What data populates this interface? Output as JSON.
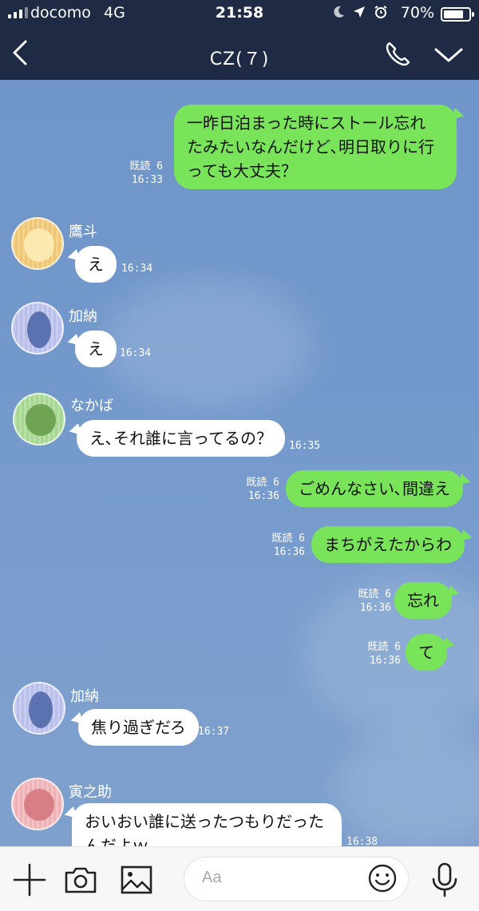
{
  "status_bar": {
    "carrier": "docomo",
    "network": "4G",
    "time": "21:58",
    "battery_percent": "70%",
    "battery_level": 0.7,
    "icons": [
      "moon-icon",
      "location-icon",
      "alarm-icon"
    ]
  },
  "header": {
    "title": "CZ(７)",
    "icons": [
      "back-icon",
      "phone-icon",
      "chevron-down-icon"
    ]
  },
  "messages": [
    {
      "direction": "out",
      "text": "一昨日泊まった時にストール忘れ\nたみたいなんだけど､明日取りに行\nっても大丈夫？",
      "read": "既読 6",
      "time": "16:33"
    },
    {
      "direction": "in",
      "sender": "鷹斗",
      "text": "え",
      "time": "16:34"
    },
    {
      "direction": "in",
      "sender": "加納",
      "text": "え",
      "time": "16:34"
    },
    {
      "direction": "in",
      "sender": "なかば",
      "text": "え､それ誰に言ってるの？",
      "time": "16:35"
    },
    {
      "direction": "out",
      "text": "ごめんなさい､間違え",
      "read": "既読 6",
      "time": "16:36"
    },
    {
      "direction": "out",
      "text": "まちがえたからわ",
      "read": "既読 6",
      "time": "16:36"
    },
    {
      "direction": "out",
      "text": "忘れ",
      "read": "既読 6",
      "time": "16:36"
    },
    {
      "direction": "out",
      "text": "て",
      "read": "既読 6",
      "time": "16:36"
    },
    {
      "direction": "in",
      "sender": "加納",
      "text": "焦り過ぎだろ",
      "time": "16:37"
    },
    {
      "direction": "in",
      "sender": "寅之助",
      "text": "おいおい誰に送ったつもりだった\nんだよｗ",
      "time": "16:38"
    }
  ],
  "input_bar": {
    "placeholder": "Aa",
    "icons": [
      "plus-icon",
      "camera-icon",
      "image-icon",
      "emoji-icon",
      "microphone-icon"
    ]
  },
  "colors": {
    "header_bg": "#1f2a44",
    "chat_bg": "#7399cc",
    "outgoing_bubble": "#79e35a",
    "incoming_bubble": "#ffffff"
  }
}
